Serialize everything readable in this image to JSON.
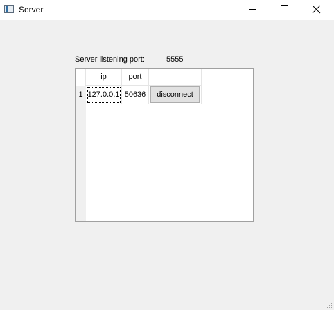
{
  "window": {
    "title": "Server",
    "icon": "app-window-icon",
    "controls": [
      "minimize-icon",
      "maximize-icon",
      "close-icon"
    ]
  },
  "server": {
    "port_label": "Server listening  port:",
    "port_value": "5555"
  },
  "table": {
    "headers": [
      "ip",
      "port",
      ""
    ],
    "rows": [
      {
        "row_number": "1",
        "ip": "127.0.0.1",
        "port": "50636",
        "action_label": "disconnect"
      }
    ]
  }
}
